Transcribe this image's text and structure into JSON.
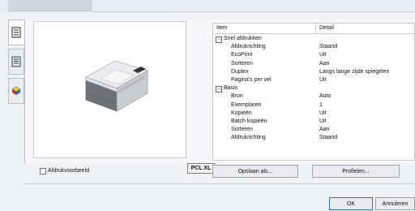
{
  "sidetabs": [
    {
      "icon": "printer-document-icon",
      "active": true
    },
    {
      "icon": "document-list-icon",
      "active": false
    },
    {
      "icon": "color-cube-icon",
      "active": false
    }
  ],
  "preview": {
    "badge": "PCL XL"
  },
  "table": {
    "headers": {
      "item": "Item",
      "detail": "Detail"
    },
    "rows": [
      {
        "item": "Snel afdrukken",
        "detail": "",
        "group": true,
        "toggle": "−"
      },
      {
        "item": "Afdrukrichting",
        "detail": "Staand",
        "group": false
      },
      {
        "item": "EcoPrint",
        "detail": "Uit",
        "group": false
      },
      {
        "item": "Sorteren",
        "detail": "Aan",
        "group": false
      },
      {
        "item": "Duplex",
        "detail": "Langs lange zijde spiegelen",
        "group": false
      },
      {
        "item": "Pagina's per vel",
        "detail": "Uit",
        "group": false
      },
      {
        "item": "Basis",
        "detail": "",
        "group": true,
        "toggle": "−"
      },
      {
        "item": "Bron",
        "detail": "Auto",
        "group": false
      },
      {
        "item": "Exemplaren",
        "detail": "1",
        "group": false
      },
      {
        "item": "Kopieën",
        "detail": "Uit",
        "group": false
      },
      {
        "item": "Batch kopieën",
        "detail": "Uit",
        "group": false
      },
      {
        "item": "Sorteren",
        "detail": "Aan",
        "group": false
      },
      {
        "item": "Afdrukrichting",
        "detail": "Staand",
        "group": false
      }
    ]
  },
  "checkbox": {
    "label": "Afdrukvoorbeeld",
    "checked": false
  },
  "buttons": {
    "save": "Opslaan als...",
    "profiles": "Profielen...",
    "ok": "OK",
    "cancel": "Annuleren"
  }
}
